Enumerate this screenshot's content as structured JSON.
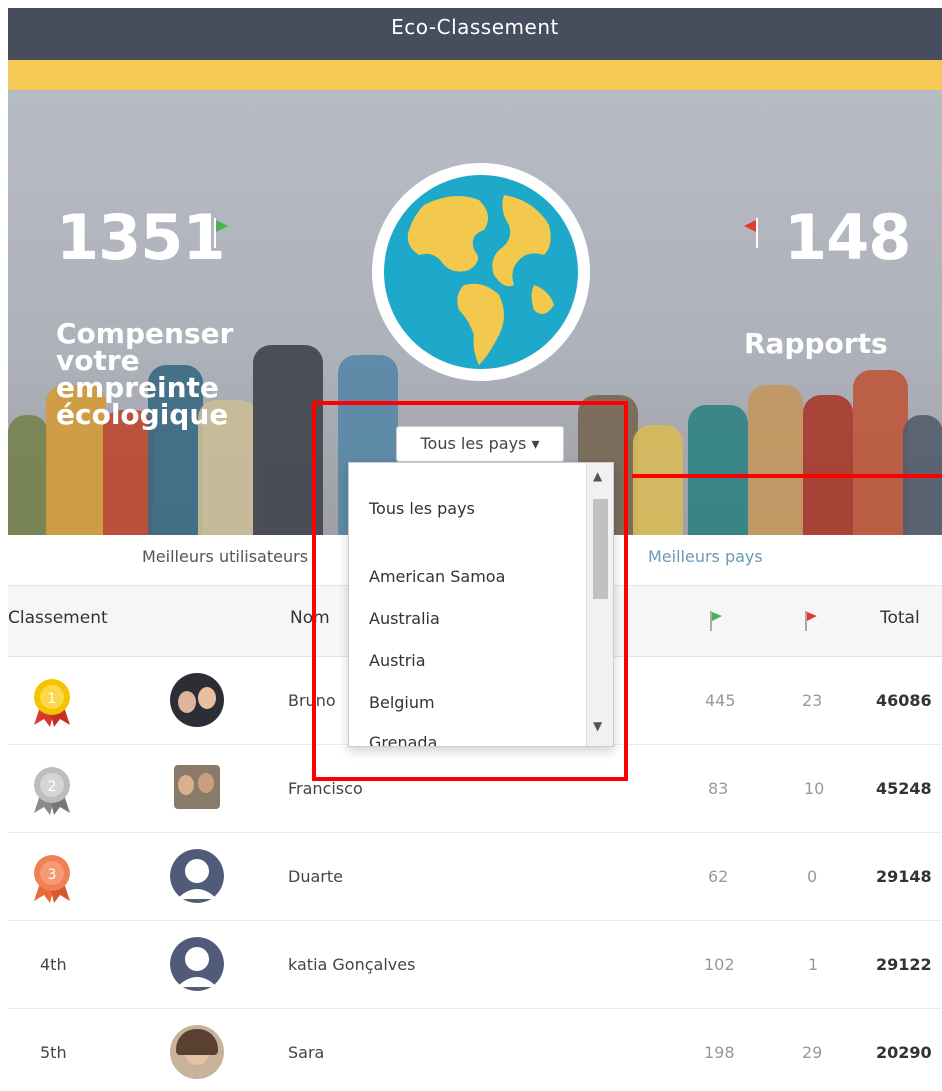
{
  "header": {
    "title": "Eco-Classement"
  },
  "stats": {
    "left": {
      "value": "1351",
      "label_lines": [
        "Compenser",
        "votre",
        "empreinte",
        "écologique"
      ],
      "flag_color": "#4caf50"
    },
    "right": {
      "value": "148",
      "label": "Rapports",
      "flag_color": "#e53935"
    }
  },
  "country_select": {
    "label": "Tous les pays ▾"
  },
  "dropdown": {
    "options": [
      "Tous les pays",
      "American Samoa",
      "Australia",
      "Austria",
      "Belgium",
      "Grenada"
    ]
  },
  "tabs": [
    {
      "label": "Meilleurs utilisateurs"
    },
    {
      "label": "Meilleurs pays"
    }
  ],
  "table": {
    "headers": {
      "rank": "Classement",
      "name": "Nom",
      "total": "Total"
    },
    "rows": [
      {
        "rank": "",
        "name": "Bruno",
        "green": "445",
        "red": "23",
        "total": "46086",
        "medal_color": "#f5c400"
      },
      {
        "rank": "",
        "name": "Francisco",
        "green": "83",
        "red": "10",
        "total": "45248",
        "medal_color": "#bdbdbd"
      },
      {
        "rank": "",
        "name": "Duarte",
        "green": "62",
        "red": "0",
        "total": "29148",
        "medal_color": "#f08055"
      },
      {
        "rank": "4th",
        "name": "katia Gonçalves",
        "green": "102",
        "red": "1",
        "total": "29122"
      },
      {
        "rank": "5th",
        "name": "Sara",
        "green": "198",
        "red": "29",
        "total": "20290"
      }
    ]
  },
  "colors": {
    "header_bg": "#464d5c",
    "accent_yellow": "#f5c955",
    "highlight": "#ff0000"
  }
}
